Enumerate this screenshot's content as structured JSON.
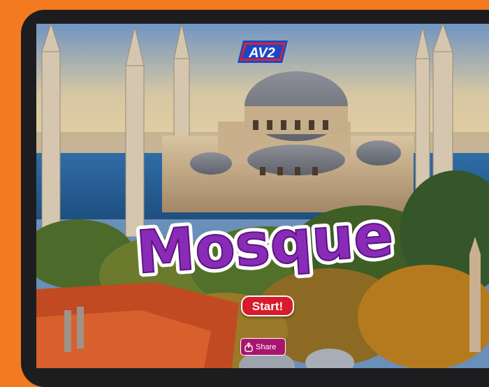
{
  "logo": {
    "text": "AV2"
  },
  "book": {
    "title": "Mosque"
  },
  "buttons": {
    "start_label": "Start!",
    "share_label": "Share"
  },
  "icons": {
    "share": "share-icon"
  },
  "colors": {
    "page_background": "#f47a22",
    "bezel": "#1d1d1f",
    "title_fill": "#8a2bb8",
    "start_button": "#d81b2c",
    "share_button": "#a9146e",
    "logo_blue": "#1947c8",
    "logo_red": "#e0202e"
  }
}
